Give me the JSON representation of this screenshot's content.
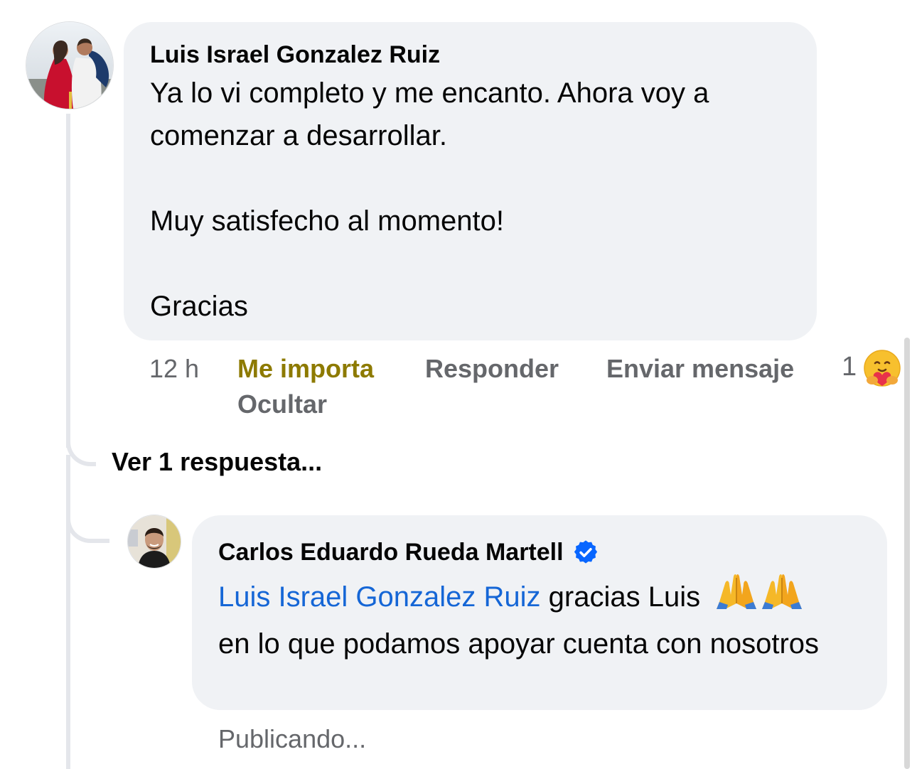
{
  "comment": {
    "author": "Luis Israel Gonzalez Ruiz",
    "paragraphs": [
      "Ya lo vi completo y me encanto. Ahora voy a comenzar a desarrollar.",
      "Muy satisfecho al momento!",
      "Gracias"
    ],
    "time": "12 h",
    "actions": {
      "like": "Me importa",
      "reply": "Responder",
      "message": "Enviar mensaje",
      "hide": "Ocultar"
    },
    "reaction_count": "1",
    "reaction_icon": "care-emoji-icon"
  },
  "replies_link": "Ver 1 respuesta...",
  "reply": {
    "author": "Carlos Eduardo Rueda Martell",
    "verified_icon": "verified-badge-icon",
    "mention": "Luis Israel Gonzalez Ruiz",
    "text_after_mention": " gracias Luis",
    "emoji": "folded-hands-icon",
    "text_second": "en lo que podamos apoyar cuenta con nosotros",
    "status": "Publicando..."
  },
  "colors": {
    "bubble": "#f0f2f5",
    "liked": "#8d7a00",
    "mention": "#1566d6",
    "muted": "#65676b",
    "verified": "#0866ff"
  }
}
